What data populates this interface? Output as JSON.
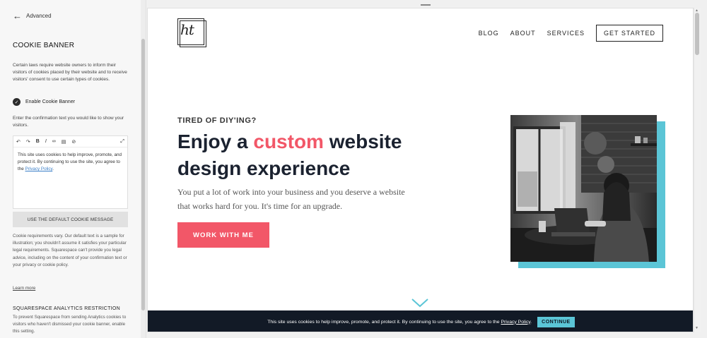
{
  "panel": {
    "back_label": "Advanced",
    "title": "COOKIE BANNER",
    "description": "Certain laws require website owners to inform their visitors of cookies placed by their website and to receive visitors' consent to use certain types of cookies.",
    "toggle_label": "Enable Cookie Banner",
    "prompt": "Enter the confirmation text you would like to show your visitors.",
    "editor": {
      "toolbar": [
        "undo-icon",
        "redo-icon",
        "bold-icon",
        "italic-icon",
        "link-icon",
        "clear-format-icon",
        "remove-icon",
        "expand-icon"
      ],
      "text_before": "This site uses cookies to help improve, promote, and protect it. By continuing to use the site, you agree to the ",
      "link_text": "Privacy Policy",
      "text_after": "."
    },
    "default_button": "USE THE DEFAULT COOKIE MESSAGE",
    "note": "Cookie requirements vary. Our default text is a sample for illustration; you shouldn't assume it satisfies your particular legal requirements. Squarespace can't provide you legal advice, including on the content of your confirmation text or your privacy or cookie policy.",
    "learn_more": "Learn more",
    "section_title": "SQUARESPACE ANALYTICS RESTRICTION",
    "section_desc": "To prevent Squarespace from sending Analytics cookies to visitors who haven't dismissed your cookie banner, enable this setting."
  },
  "site": {
    "logo_text": "ht",
    "nav": [
      "BLOG",
      "ABOUT",
      "SERVICES"
    ],
    "nav_cta": "GET STARTED",
    "eyebrow": "TIRED OF DIY'ING?",
    "headline_pre": "Enjoy a ",
    "headline_accent": "custom",
    "headline_post": " website design experience",
    "body": "You put a lot of work into your business and you deserve a website that works hard for you. It's time for an upgrade.",
    "button": "WORK WITH ME",
    "cookie_bar": {
      "text_before": "This site uses cookies to help improve, promote, and protect it. By continuing to use the site, you agree to the ",
      "link_text": "Privacy Policy",
      "text_after": ".",
      "button": "CONTINUE"
    }
  },
  "colors": {
    "accent": "#f25768",
    "teal": "#5bc5d6",
    "dark": "#121a26"
  }
}
